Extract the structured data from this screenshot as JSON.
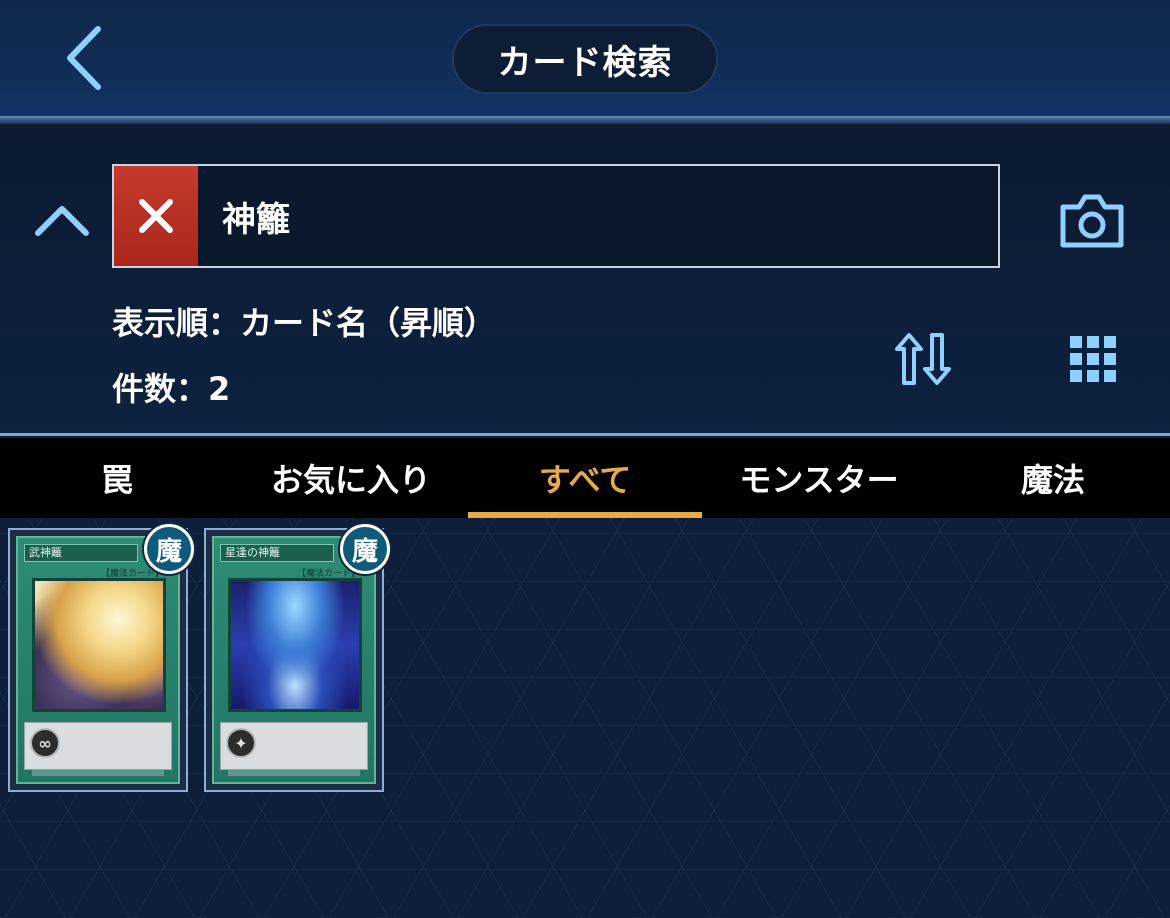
{
  "header": {
    "title": "カード検索"
  },
  "search": {
    "query": "神籬",
    "placeholder": ""
  },
  "sort": {
    "label": "表示順：カード名（昇順）"
  },
  "result": {
    "label": "件数：2"
  },
  "tabs": [
    {
      "label": "罠",
      "active": false
    },
    {
      "label": "お気に入り",
      "active": false
    },
    {
      "label": "すべて",
      "active": true
    },
    {
      "label": "モンスター",
      "active": false
    },
    {
      "label": "魔法",
      "active": false
    }
  ],
  "cards": [
    {
      "name": "武神籬",
      "type": "【魔法カード】",
      "badge": "魔",
      "icon": "∞"
    },
    {
      "name": "星逢の神籬",
      "type": "【魔法カード】",
      "badge": "魔",
      "icon": "✦"
    }
  ],
  "colors": {
    "accent": "#e8a94a",
    "clear_button": "#c63a2c",
    "icon_glow": "#8fd0ff"
  }
}
